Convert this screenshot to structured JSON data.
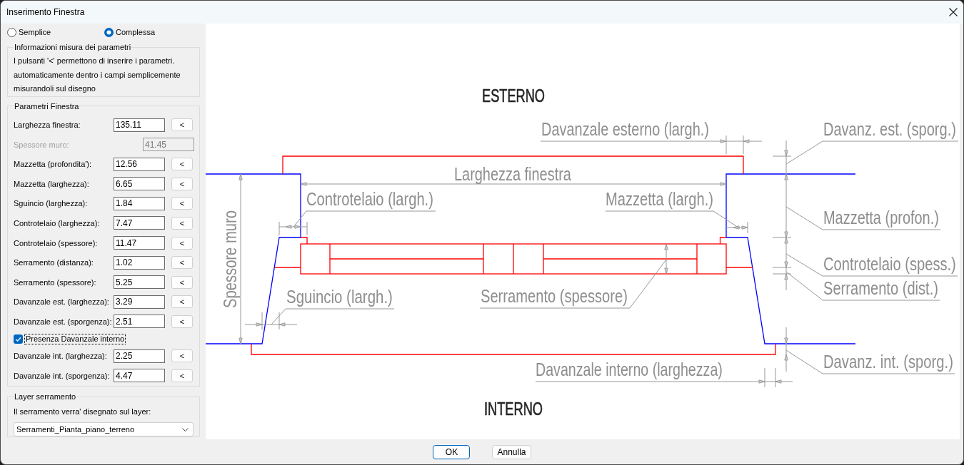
{
  "window": {
    "title": "Inserimento Finestra"
  },
  "mode_options": [
    {
      "label": "Semplice",
      "selected": false
    },
    {
      "label": "Complessa",
      "selected": true
    }
  ],
  "info_group": {
    "title": "Informazioni misura dei parametri",
    "text": "I pulsanti '<' permettono di inserire i parametri.\nautomaticamente dentro i campi semplicemente\nmisurandoli sul disegno"
  },
  "parameters_group": {
    "title": "Parametri Finestra",
    "rows": [
      {
        "kind": "field",
        "label": "Larghezza finestra:",
        "value": "135.11",
        "disabled": false,
        "button": "<"
      },
      {
        "kind": "field",
        "label": "Spessore muro:",
        "value": "41.45",
        "disabled": true
      },
      {
        "kind": "field",
        "label": "Mazzetta (profondita'):",
        "value": "12.56",
        "disabled": false,
        "button": "<"
      },
      {
        "kind": "field",
        "label": "Mazzetta (larghezza):",
        "value": "6.65",
        "disabled": false,
        "button": "<"
      },
      {
        "kind": "field",
        "label": "Sguincio (larghezza):",
        "value": "1.84",
        "disabled": false,
        "button": "<"
      },
      {
        "kind": "field",
        "label": "Controtelaio (larghezza):",
        "value": "7.47",
        "disabled": false,
        "button": "<"
      },
      {
        "kind": "field",
        "label": "Controtelaio (spessore):",
        "value": "11.47",
        "disabled": false,
        "button": "<"
      },
      {
        "kind": "field",
        "label": "Serramento (distanza):",
        "value": "1.02",
        "disabled": false,
        "button": "<"
      },
      {
        "kind": "field",
        "label": "Serramento (spessore):",
        "value": "5.25",
        "disabled": false,
        "button": "<"
      },
      {
        "kind": "field",
        "label": "Davanzale est. (larghezza):",
        "value": "3.29",
        "disabled": false,
        "button": "<"
      },
      {
        "kind": "field",
        "label": "Davanzale est. (sporgenza):",
        "value": "2.51",
        "disabled": false,
        "button": "<"
      },
      {
        "kind": "checkbox",
        "label": "Presenza Davanzale interno",
        "checked": true,
        "focused": true
      },
      {
        "kind": "field",
        "label": "Davanzale int. (larghezza):",
        "value": "2.25",
        "disabled": false,
        "button": "<"
      },
      {
        "kind": "field",
        "label": "Davanzale int. (sporgenza):",
        "value": "4.47",
        "disabled": false,
        "button": "<"
      }
    ]
  },
  "layer_group": {
    "title": "Layer serramento",
    "prompt": "Il serramento verra' disegnato sul layer:",
    "layer_dropdown": {
      "value": "Serramenti_Pianta_piano_terreno"
    }
  },
  "drawing": {
    "side_labels": [
      "ESTERNO",
      "INTERNO"
    ],
    "dimension_labels": [
      "Davanzale esterno (largh.)",
      "Davanz. est. (sporg.)",
      "Larghezza finestra",
      "Controtelaio (largh.)",
      "Mazzetta (largh.)",
      "Mazzetta (profon.)",
      "Spessore muro",
      "Controtelaio (spess.)",
      "Serramento (dist.)",
      "Sguincio (largh.)",
      "Serramento (spessore)",
      "Davanz. int. (sporg.)",
      "Davanzale interno (larghezza)"
    ]
  },
  "buttons": [
    {
      "label": "OK",
      "default": true
    },
    {
      "label": "Annulla",
      "default": false
    }
  ]
}
